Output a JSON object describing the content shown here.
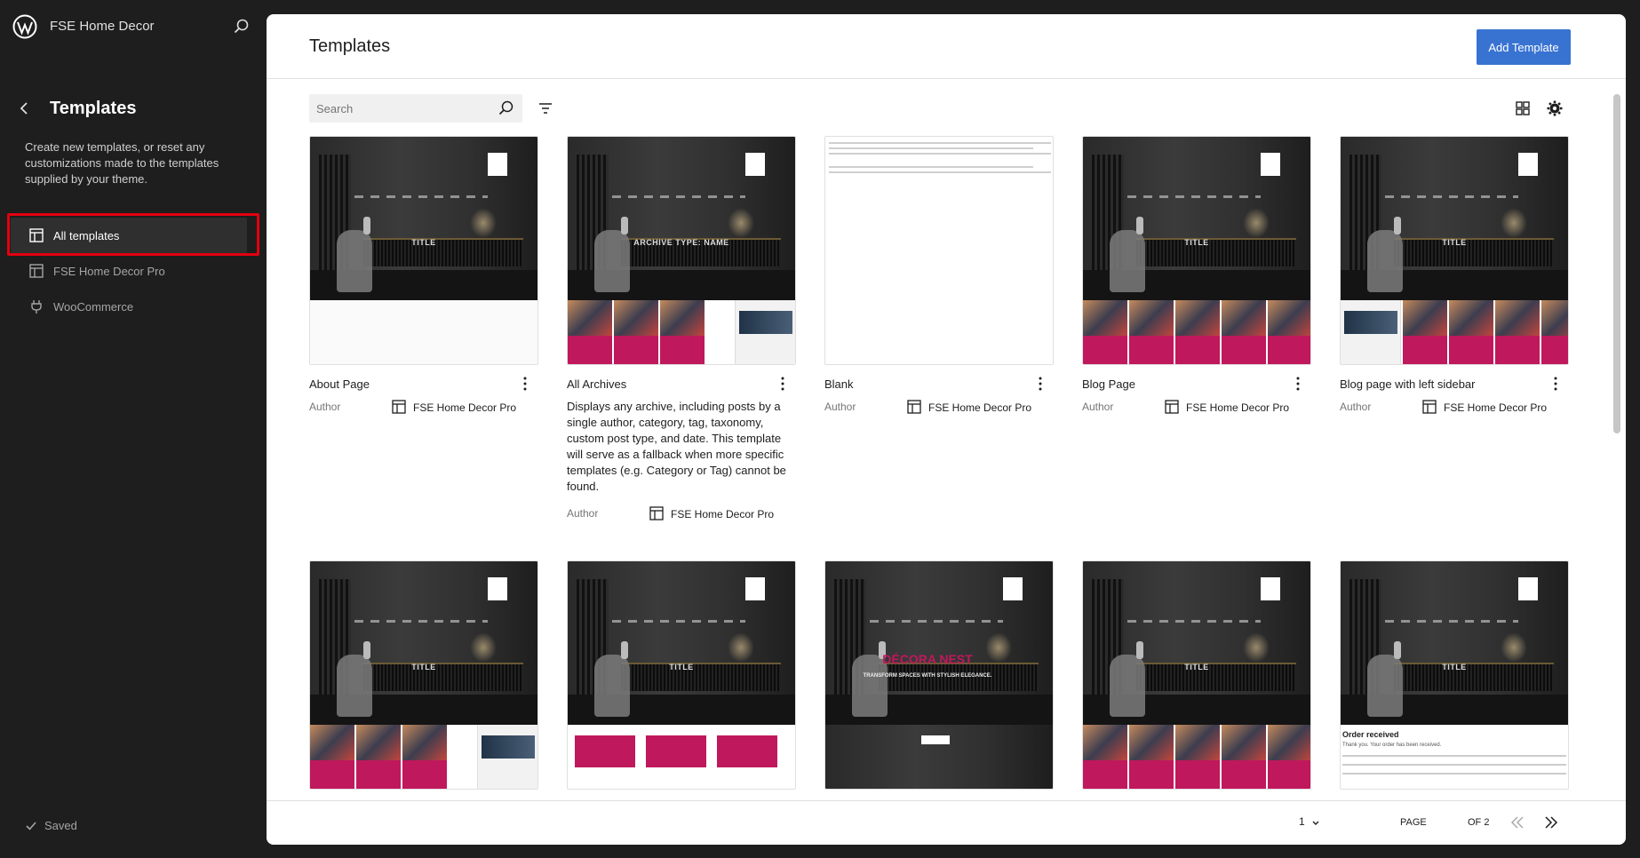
{
  "site": {
    "title": "FSE Home Decor"
  },
  "sidebar": {
    "title": "Templates",
    "description": "Create new templates, or reset any customizations made to the templates supplied by your theme.",
    "items": [
      {
        "label": "All templates",
        "icon": "layout-icon",
        "active": true
      },
      {
        "label": "FSE Home Decor Pro",
        "icon": "layout-icon",
        "active": false
      },
      {
        "label": "WooCommerce",
        "icon": "plugin-icon",
        "active": false
      }
    ],
    "status": "Saved"
  },
  "main": {
    "title": "Templates",
    "add_button": "Add Template",
    "search_placeholder": "Search",
    "author_label": "Author"
  },
  "templates": [
    {
      "title": "About Page",
      "description": "",
      "author": "FSE Home Decor Pro",
      "thumb": "about",
      "hero_label": "TITLE"
    },
    {
      "title": "All Archives",
      "description": "Displays any archive, including posts by a single author, category, tag, taxonomy, custom post type, and date. This template will serve as a fallback when more specific templates (e.g. Category or Tag) cannot be found.",
      "author": "FSE Home Decor Pro",
      "thumb": "archive",
      "hero_label": "ARCHIVE TYPE: NAME"
    },
    {
      "title": "Blank",
      "description": "",
      "author": "FSE Home Decor Pro",
      "thumb": "blank",
      "hero_label": ""
    },
    {
      "title": "Blog Page",
      "description": "",
      "author": "FSE Home Decor Pro",
      "thumb": "blog",
      "hero_label": "TITLE"
    },
    {
      "title": "Blog page with left sidebar",
      "description": "",
      "author": "FSE Home Decor Pro",
      "thumb": "leftsidebar",
      "hero_label": "TITLE"
    },
    {
      "title": "",
      "description": "",
      "author": "",
      "thumb": "archive",
      "hero_label": "TITLE"
    },
    {
      "title": "",
      "description": "",
      "author": "",
      "thumb": "contact",
      "hero_label": "TITLE"
    },
    {
      "title": "",
      "description": "",
      "author": "",
      "thumb": "front",
      "hero_label": ""
    },
    {
      "title": "",
      "description": "",
      "author": "",
      "thumb": "blog",
      "hero_label": "TITLE"
    },
    {
      "title": "",
      "description": "",
      "author": "",
      "thumb": "order",
      "hero_label": "TITLE"
    }
  ],
  "thumb_text": {
    "front_heading": "DÉCORA NEST",
    "front_sub": "TRANSFORM SPACES WITH STYLISH ELEGANCE.",
    "order_title": "Order received",
    "order_text": "Thank you. Your order has been received."
  },
  "pagination": {
    "page_label": "PAGE",
    "current": "1",
    "of_label": "OF 2"
  },
  "colors": {
    "accent": "#3873d2",
    "highlight": "#e3000f",
    "brand_pink": "#c0185c"
  }
}
